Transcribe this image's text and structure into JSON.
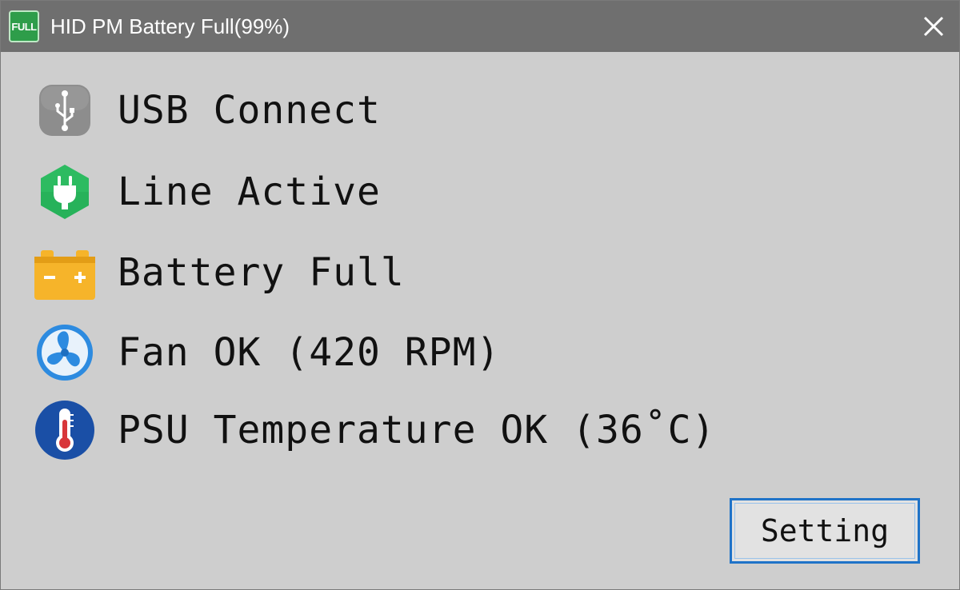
{
  "window": {
    "title": "HID PM Battery Full(99%)",
    "app_icon_text": "FULL",
    "close_label": "×",
    "accent_color": "#1f73c8"
  },
  "status": {
    "items": [
      {
        "icon": "usb-icon",
        "label": "USB Connect",
        "color": "#8d8d8d"
      },
      {
        "icon": "plug-icon",
        "label": "Line Active",
        "color": "#27b25a"
      },
      {
        "icon": "battery-icon",
        "label": "Battery Full",
        "color": "#f6b42a"
      },
      {
        "icon": "fan-icon",
        "label": "Fan OK (420 RPM)",
        "color": "#2d8be0"
      },
      {
        "icon": "thermometer-icon",
        "label": "PSU Temperature OK (36˚C)",
        "color": "#1a4fa6"
      }
    ]
  },
  "footer": {
    "setting_label": "Setting"
  }
}
